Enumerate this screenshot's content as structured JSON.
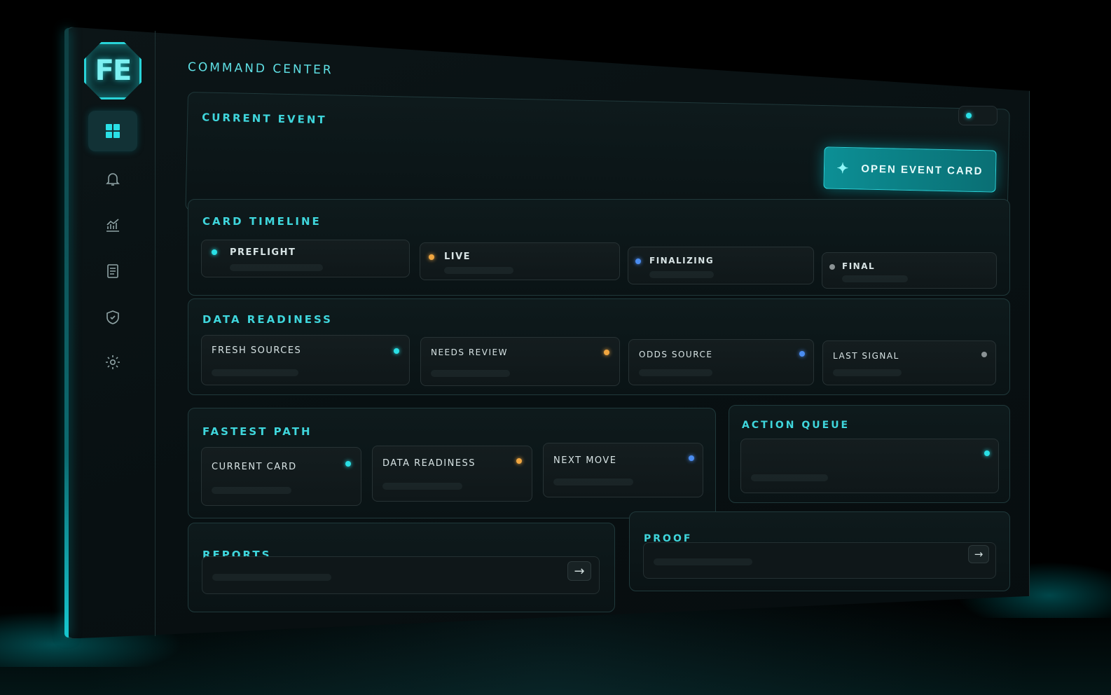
{
  "brand": {
    "logo_text": "FE"
  },
  "sidebar": {
    "items": [
      {
        "name": "dashboard",
        "icon": "grid-icon",
        "active": true
      },
      {
        "name": "alerts",
        "icon": "bell-icon"
      },
      {
        "name": "analytics",
        "icon": "chart-icon"
      },
      {
        "name": "documents",
        "icon": "document-icon"
      },
      {
        "name": "security",
        "icon": "shield-icon"
      },
      {
        "name": "settings",
        "icon": "gear-icon"
      }
    ]
  },
  "page": {
    "title": "COMMAND CENTER"
  },
  "current_event": {
    "title": "CURRENT EVENT",
    "open_button_label": "OPEN EVENT CARD",
    "button_icon": "sparkle-icon"
  },
  "card_timeline": {
    "title": "CARD TIMELINE",
    "stages": [
      {
        "label": "PREFLIGHT",
        "status_color": "#2ae0e6"
      },
      {
        "label": "LIVE",
        "status_color": "#f0a640"
      },
      {
        "label": "FINALIZING",
        "status_color": "#4a8cf0"
      },
      {
        "label": "FINAL",
        "status_color": "#8a9294"
      }
    ]
  },
  "data_readiness": {
    "title": "DATA READINESS",
    "tiles": [
      {
        "label": "FRESH SOURCES",
        "status_color": "#2ae0e6"
      },
      {
        "label": "NEEDS REVIEW",
        "status_color": "#f0a640"
      },
      {
        "label": "ODDS SOURCE",
        "status_color": "#4a8cf0"
      },
      {
        "label": "LAST SIGNAL",
        "status_color": "#8a9294"
      }
    ]
  },
  "fastest_path": {
    "title": "FASTEST PATH",
    "tiles": [
      {
        "label": "CURRENT CARD",
        "status_color": "#2ae0e6"
      },
      {
        "label": "DATA READINESS",
        "status_color": "#f0a640"
      },
      {
        "label": "NEXT MOVE",
        "status_color": "#4a8cf0"
      }
    ]
  },
  "action_queue": {
    "title": "ACTION QUEUE"
  },
  "reports": {
    "title": "REPORTS",
    "arrow_icon": "arrow-right-icon"
  },
  "proof": {
    "title": "PROOF",
    "arrow_icon": "arrow-right-icon"
  },
  "colors": {
    "accent": "#2ae0e6",
    "amber": "#f0a640",
    "blue": "#4a8cf0",
    "neutral": "#8a9294",
    "background": "#0a1315"
  }
}
